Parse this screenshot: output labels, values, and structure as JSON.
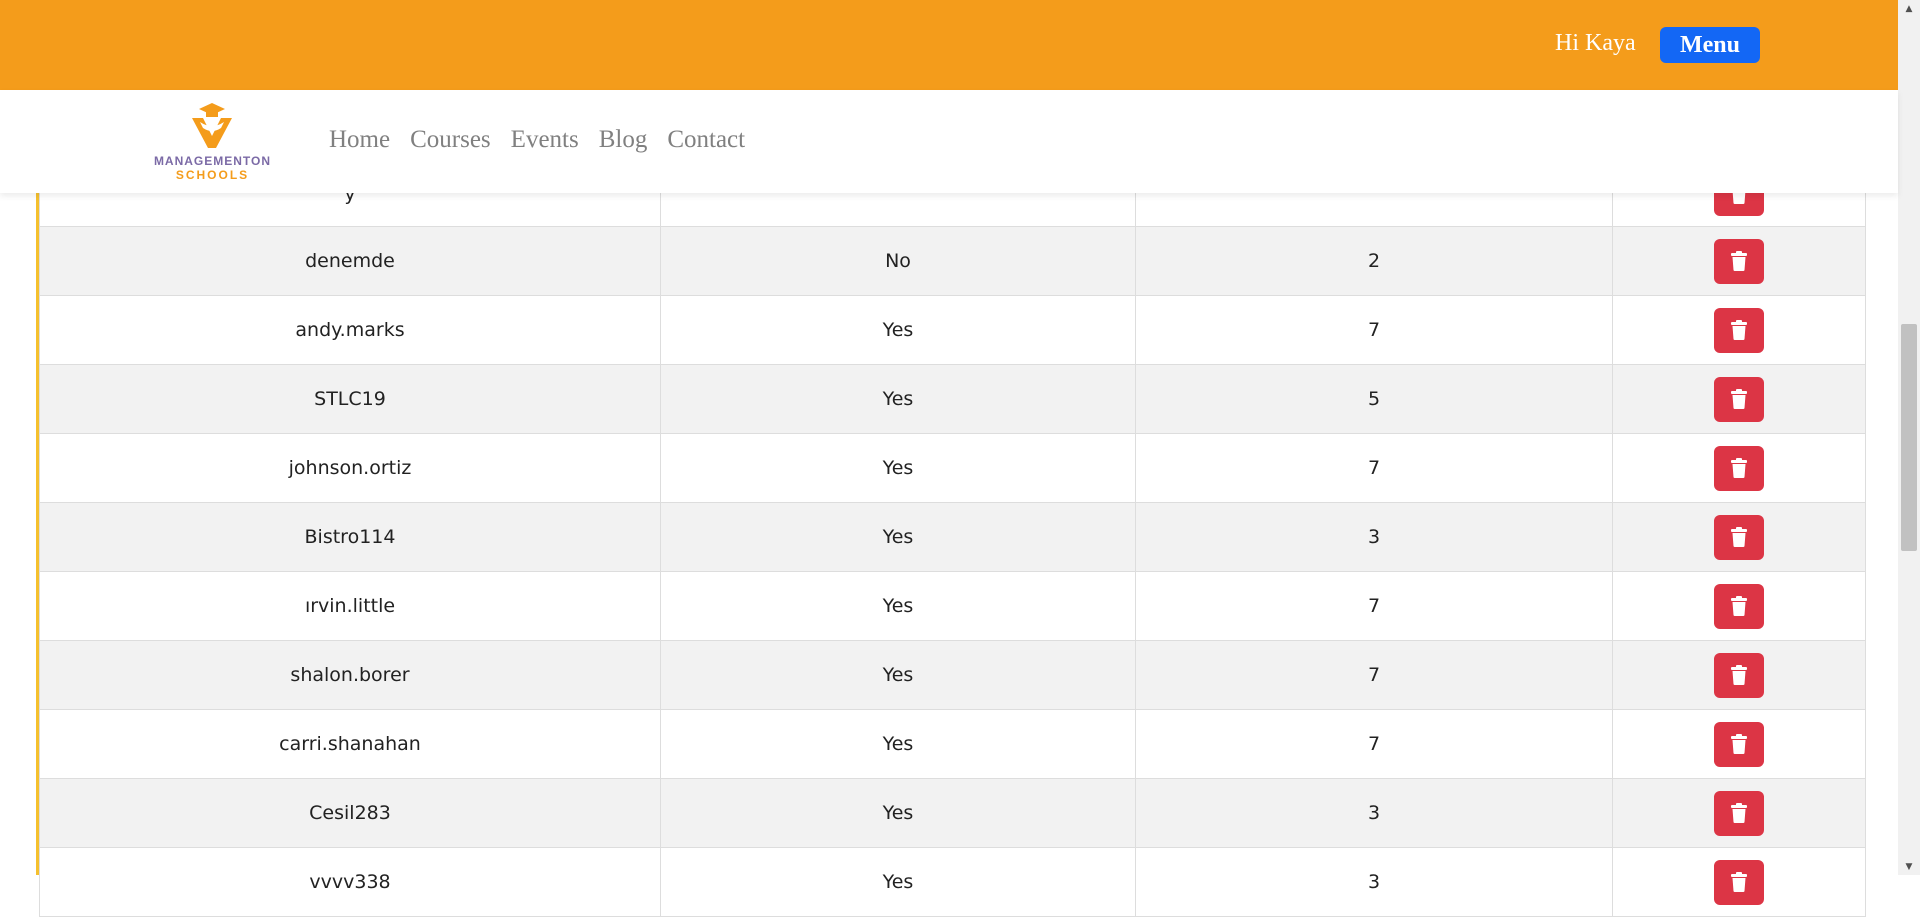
{
  "header": {
    "greeting": "Hi Kaya",
    "menu_label": "Menu"
  },
  "brand": {
    "line1": "MANAGEMENTON",
    "line2": "SCHOOLS"
  },
  "nav": {
    "items": [
      "Home",
      "Courses",
      "Events",
      "Blog",
      "Contact"
    ]
  },
  "table": {
    "partial_top_row": {
      "username": "y"
    },
    "rows": [
      {
        "username": "denemde",
        "active": "No",
        "count": "2"
      },
      {
        "username": "andy.marks",
        "active": "Yes",
        "count": "7"
      },
      {
        "username": "STLC19",
        "active": "Yes",
        "count": "5"
      },
      {
        "username": "johnson.ortiz",
        "active": "Yes",
        "count": "7"
      },
      {
        "username": "Bistro114",
        "active": "Yes",
        "count": "3"
      },
      {
        "username": "ırvin.little",
        "active": "Yes",
        "count": "7"
      },
      {
        "username": "shalon.borer",
        "active": "Yes",
        "count": "7"
      },
      {
        "username": "carri.shanahan",
        "active": "Yes",
        "count": "7"
      },
      {
        "username": "Cesil283",
        "active": "Yes",
        "count": "3"
      },
      {
        "username": "vvvv338",
        "active": "Yes",
        "count": "3"
      }
    ]
  },
  "colors": {
    "topbar": "#f49c1b",
    "menu_button": "#1367f5",
    "delete_button": "#dc3545",
    "frame_border": "#f5c02e"
  },
  "icons": {
    "delete": "trash-icon",
    "logo": "graduation-cap-logo"
  }
}
